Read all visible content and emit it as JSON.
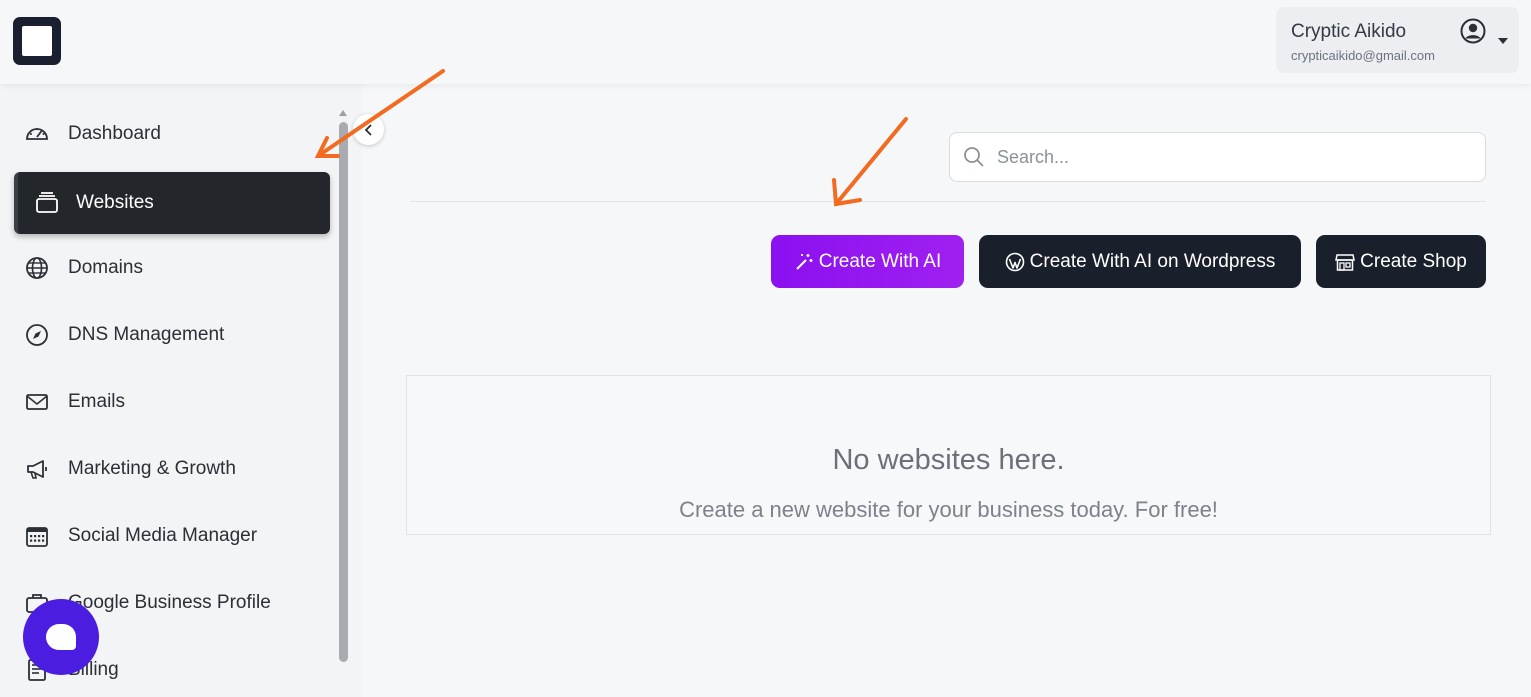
{
  "header": {
    "user_name": "Cryptic Aikido",
    "user_email": "crypticaikido@gmail.com"
  },
  "sidebar": {
    "items": [
      {
        "label": "Dashboard",
        "icon": "speedometer-icon"
      },
      {
        "label": "Websites",
        "icon": "window-stack-icon",
        "active": true
      },
      {
        "label": "Domains",
        "icon": "globe-icon"
      },
      {
        "label": "DNS Management",
        "icon": "compass-icon"
      },
      {
        "label": "Emails",
        "icon": "envelope-icon"
      },
      {
        "label": "Marketing & Growth",
        "icon": "megaphone-icon"
      },
      {
        "label": "Social Media Manager",
        "icon": "calendar-icon"
      },
      {
        "label": "Google Business Profile",
        "icon": "briefcase-icon"
      },
      {
        "label": "Billing",
        "icon": "receipt-icon"
      }
    ]
  },
  "main": {
    "search_placeholder": "Search...",
    "buttons": {
      "create_ai": "Create With AI",
      "create_wp": "Create With AI on Wordpress",
      "create_shop": "Create Shop"
    },
    "empty_state": {
      "title": "No websites here.",
      "subtitle": "Create a new website for your business today. For free!"
    }
  },
  "colors": {
    "accent_purple": "#9616f0",
    "dark_button": "#1a1f2c",
    "chat_bubble": "#4a1de0",
    "annotation_arrow": "#f26b21"
  }
}
